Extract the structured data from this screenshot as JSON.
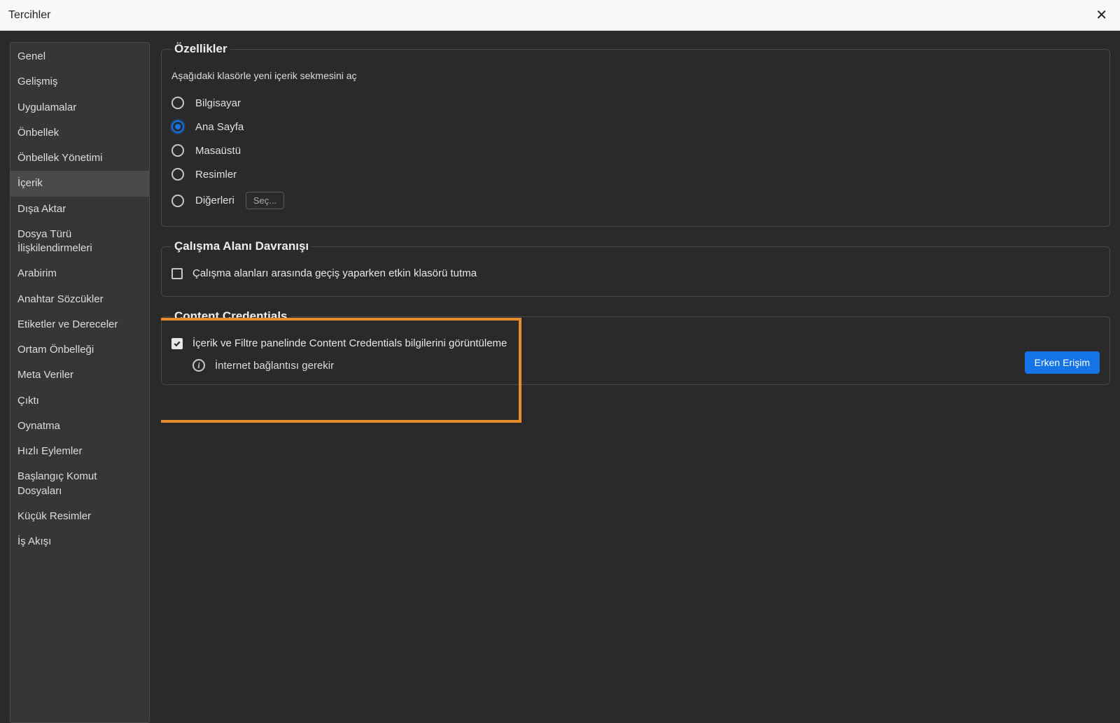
{
  "window": {
    "title": "Tercihler"
  },
  "sidebar": {
    "items": [
      {
        "label": "Genel"
      },
      {
        "label": "Gelişmiş"
      },
      {
        "label": "Uygulamalar"
      },
      {
        "label": "Önbellek"
      },
      {
        "label": "Önbellek Yönetimi"
      },
      {
        "label": "İçerik",
        "selected": true
      },
      {
        "label": "Dışa Aktar"
      },
      {
        "label": "Dosya Türü İlişkilendirmeleri"
      },
      {
        "label": "Arabirim"
      },
      {
        "label": "Anahtar Sözcükler"
      },
      {
        "label": "Etiketler ve Dereceler"
      },
      {
        "label": "Ortam Önbelleği"
      },
      {
        "label": "Meta Veriler"
      },
      {
        "label": "Çıktı"
      },
      {
        "label": "Oynatma"
      },
      {
        "label": "Hızlı Eylemler"
      },
      {
        "label": "Başlangıç Komut Dosyaları"
      },
      {
        "label": "Küçük Resimler"
      },
      {
        "label": "İş Akışı"
      }
    ]
  },
  "features": {
    "legend": "Özellikler",
    "description": "Aşağıdaki klasörle yeni içerik sekmesini aç",
    "options": [
      {
        "label": "Bilgisayar",
        "checked": false
      },
      {
        "label": "Ana Sayfa",
        "checked": true
      },
      {
        "label": "Masaüstü",
        "checked": false
      },
      {
        "label": "Resimler",
        "checked": false
      },
      {
        "label": "Diğerleri",
        "checked": false,
        "has_select": true
      }
    ],
    "select_button": "Seç..."
  },
  "workspace": {
    "legend": "Çalışma Alanı Davranışı",
    "checkbox": {
      "label": "Çalışma alanları arasında geçiş yaparken etkin klasörü tutma",
      "checked": false
    }
  },
  "credentials": {
    "legend": "Content Credentials",
    "checkbox": {
      "label": "İçerik ve Filtre panelinde Content Credentials bilgilerini görüntüleme",
      "checked": true
    },
    "info": "İnternet bağlantısı gerekir",
    "button": "Erken Erişim"
  }
}
